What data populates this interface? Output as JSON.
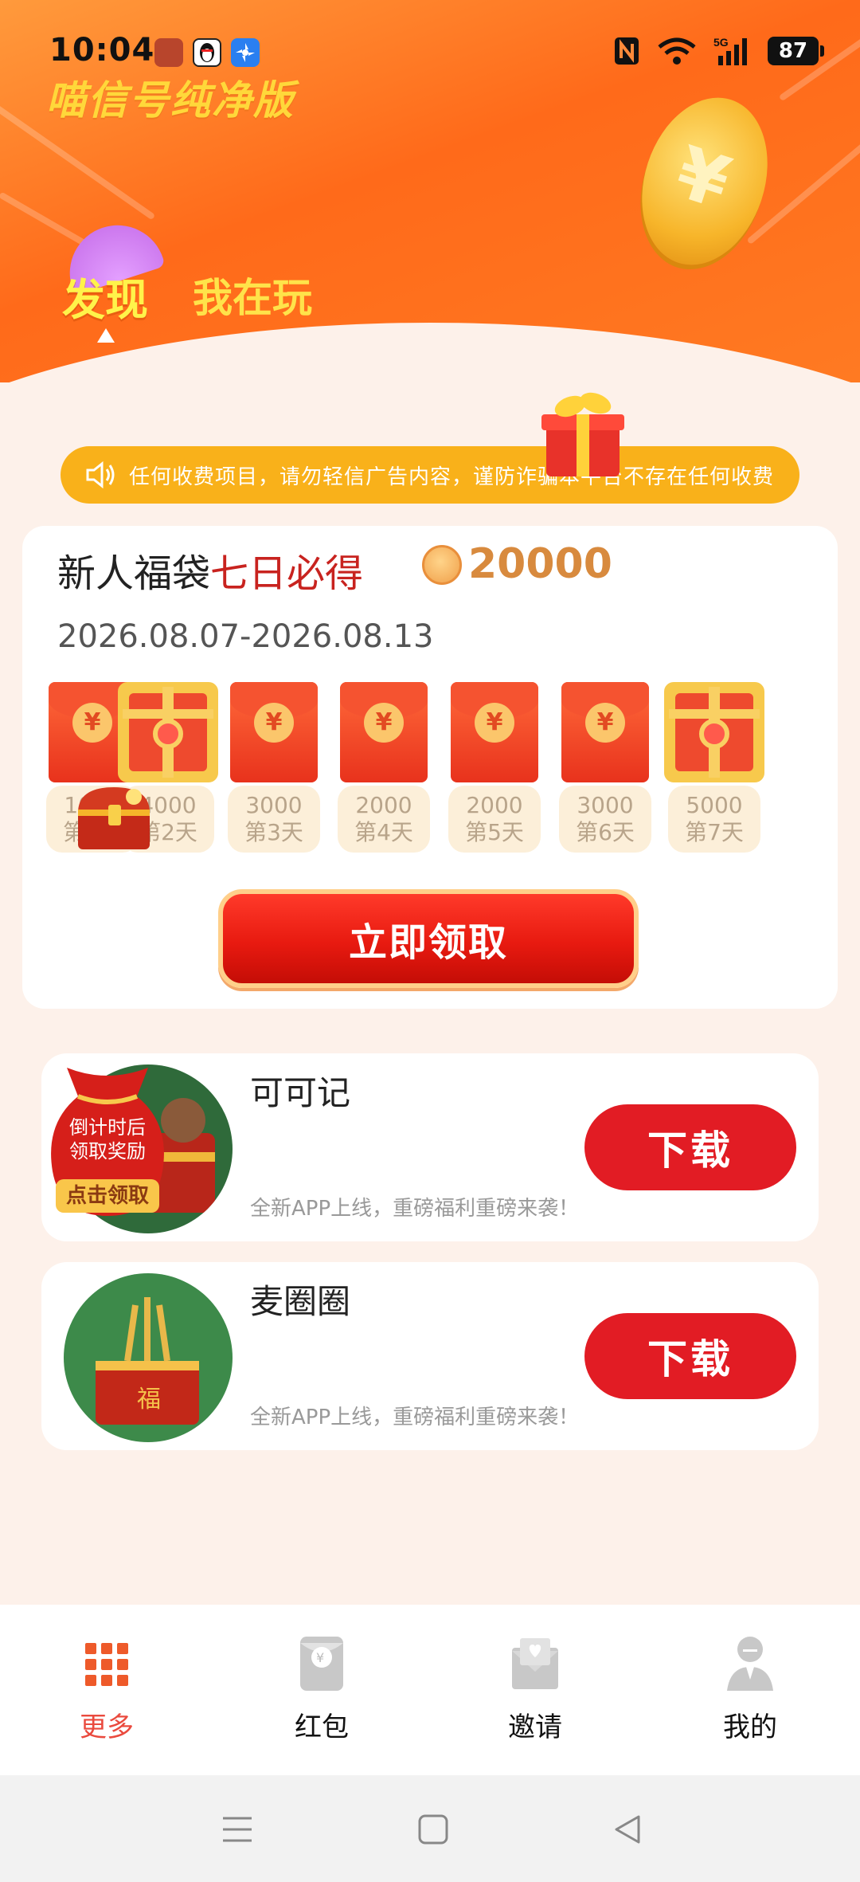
{
  "status_bar": {
    "time": "10:04",
    "battery": "87",
    "icons": [
      "nfc-icon",
      "wifi-icon",
      "5g-signal-icon",
      "battery-icon"
    ]
  },
  "header": {
    "watermark": "喵信号纯净版",
    "tabs": [
      {
        "label": "发现",
        "active": true
      },
      {
        "label": "我在玩",
        "active": false
      }
    ]
  },
  "notice": {
    "text": "任何收费项目，请勿轻信广告内容，谨防诈骗本平台不存在任何收费"
  },
  "welfare": {
    "title_part1": "新人福袋",
    "title_part2": "七日必得",
    "reward_amount": "20000",
    "date_range": "2026.08.07-2026.08.13",
    "days": [
      {
        "amount": "1000",
        "day": "第1天",
        "type": "envelope"
      },
      {
        "amount": "4000",
        "day": "第2天",
        "type": "gift"
      },
      {
        "amount": "3000",
        "day": "第3天",
        "type": "envelope"
      },
      {
        "amount": "2000",
        "day": "第4天",
        "type": "envelope"
      },
      {
        "amount": "2000",
        "day": "第5天",
        "type": "envelope"
      },
      {
        "amount": "3000",
        "day": "第6天",
        "type": "envelope"
      },
      {
        "amount": "5000",
        "day": "第7天",
        "type": "gift"
      }
    ],
    "claim_button": "立即领取"
  },
  "countdown_badge": {
    "text_line1": "倒计时后",
    "text_line2": "领取奖励",
    "cta": "点击领取"
  },
  "apps": [
    {
      "name": "可可记",
      "desc": "全新APP上线，重磅福利重磅来袭！",
      "button": "下载"
    },
    {
      "name": "麦圈圈",
      "desc": "全新APP上线，重磅福利重磅来袭！",
      "button": "下载"
    }
  ],
  "bottom_nav": [
    {
      "label": "更多",
      "icon": "grid-icon",
      "active": true
    },
    {
      "label": "红包",
      "icon": "red-envelope-icon",
      "active": false
    },
    {
      "label": "邀请",
      "icon": "invite-heart-envelope-icon",
      "active": false
    },
    {
      "label": "我的",
      "icon": "profile-icon",
      "active": false
    }
  ],
  "colors": {
    "accent_red": "#e21c24",
    "header_orange": "#ff6a1a",
    "notice_yellow": "#f9b11a",
    "active_nav": "#ea4a3e"
  }
}
